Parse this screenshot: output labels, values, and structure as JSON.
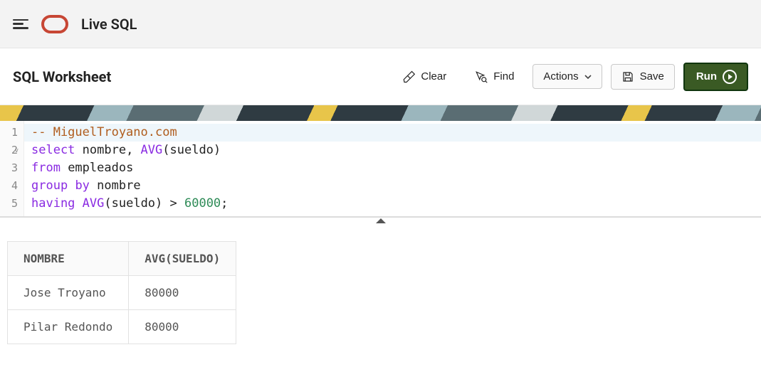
{
  "app": {
    "title": "Live SQL"
  },
  "page": {
    "title": "SQL Worksheet"
  },
  "toolbar": {
    "clear": "Clear",
    "find": "Find",
    "actions": "Actions",
    "save": "Save",
    "run": "Run"
  },
  "editor": {
    "lines": [
      {
        "n": "1",
        "html": "<span class='cmt'>-- MiguelTroyano.com</span>",
        "hl": true
      },
      {
        "n": "2",
        "html": "<span class='kw'>select</span> nombre, <span class='fn'>AVG</span>(sueldo)",
        "fold": true
      },
      {
        "n": "3",
        "html": "<span class='kw'>from</span> empleados"
      },
      {
        "n": "4",
        "html": "<span class='kw'>group</span> <span class='kw'>by</span> nombre"
      },
      {
        "n": "5",
        "html": "<span class='kw'>having</span> <span class='fn'>AVG</span>(sueldo) > <span class='num'>60000</span>;"
      }
    ]
  },
  "results": {
    "columns": [
      "NOMBRE",
      "AVG(SUELDO)"
    ],
    "rows": [
      [
        "Jose Troyano",
        "80000"
      ],
      [
        "Pilar Redondo",
        "80000"
      ]
    ]
  }
}
